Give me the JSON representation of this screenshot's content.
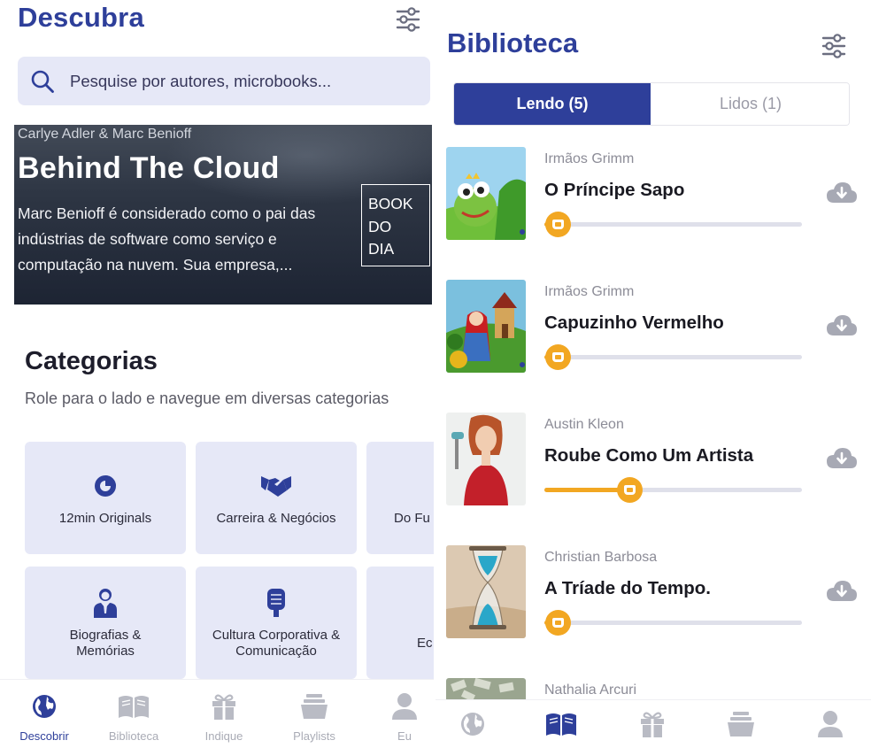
{
  "discover": {
    "title": "Descubra",
    "search_placeholder": "Pesquise por autores, microbooks...",
    "hero": {
      "authors": "Carlye Adler & Marc Benioff",
      "title": "Behind The Cloud",
      "description": "Marc Benioff é considerado como o pai das indústrias de software como serviço e computação na nuvem. Sua empresa,...",
      "badge": "BOOK DO DIA"
    },
    "categories": {
      "title": "Categorias",
      "subtitle": "Role para o lado e navegue em diversas categorias",
      "items": [
        {
          "label": "12min Originals",
          "icon": "originals-icon"
        },
        {
          "label": "Carreira & Negócios",
          "icon": "handshake-icon"
        },
        {
          "label": "Do Fu",
          "icon": ""
        },
        {
          "label": "Biografias &\nMemórias",
          "icon": "person-suit-icon"
        },
        {
          "label": "Cultura Corporativa &\nComunicação",
          "icon": "microphone-icon"
        },
        {
          "label": "Ec",
          "icon": ""
        }
      ]
    },
    "nav": [
      {
        "label": "Descobrir",
        "icon": "globe-icon",
        "active": true
      },
      {
        "label": "Biblioteca",
        "icon": "book-icon",
        "active": false
      },
      {
        "label": "Indique",
        "icon": "gift-icon",
        "active": false
      },
      {
        "label": "Playlists",
        "icon": "playlist-icon",
        "active": false
      },
      {
        "label": "Eu",
        "icon": "user-icon",
        "active": false
      }
    ]
  },
  "library": {
    "title": "Biblioteca",
    "tabs": [
      {
        "label": "Lendo (5)",
        "active": true
      },
      {
        "label": "Lidos (1)",
        "active": false
      }
    ],
    "books": [
      {
        "author": "Irmãos Grimm",
        "title": "O Príncipe Sapo",
        "progress": 0.05
      },
      {
        "author": "Irmãos Grimm",
        "title": "Capuzinho Vermelho",
        "progress": 0.05
      },
      {
        "author": "Austin Kleon",
        "title": "Roube Como Um Artista",
        "progress": 0.33
      },
      {
        "author": "Christian Barbosa",
        "title": "A Tríade do Tempo.",
        "progress": 0.05
      },
      {
        "author": "Nathalia Arcuri",
        "title": "",
        "progress": 0
      }
    ],
    "nav": [
      {
        "icon": "globe-icon",
        "active": false
      },
      {
        "icon": "book-icon",
        "active": true
      },
      {
        "icon": "gift-icon",
        "active": false
      },
      {
        "icon": "playlist-icon",
        "active": false
      },
      {
        "icon": "user-icon",
        "active": false
      }
    ]
  },
  "colors": {
    "brand": "#2e3f9a",
    "card_bg": "#e6e8f7",
    "progress": "#f2a722",
    "inactive": "#a9abb5"
  }
}
